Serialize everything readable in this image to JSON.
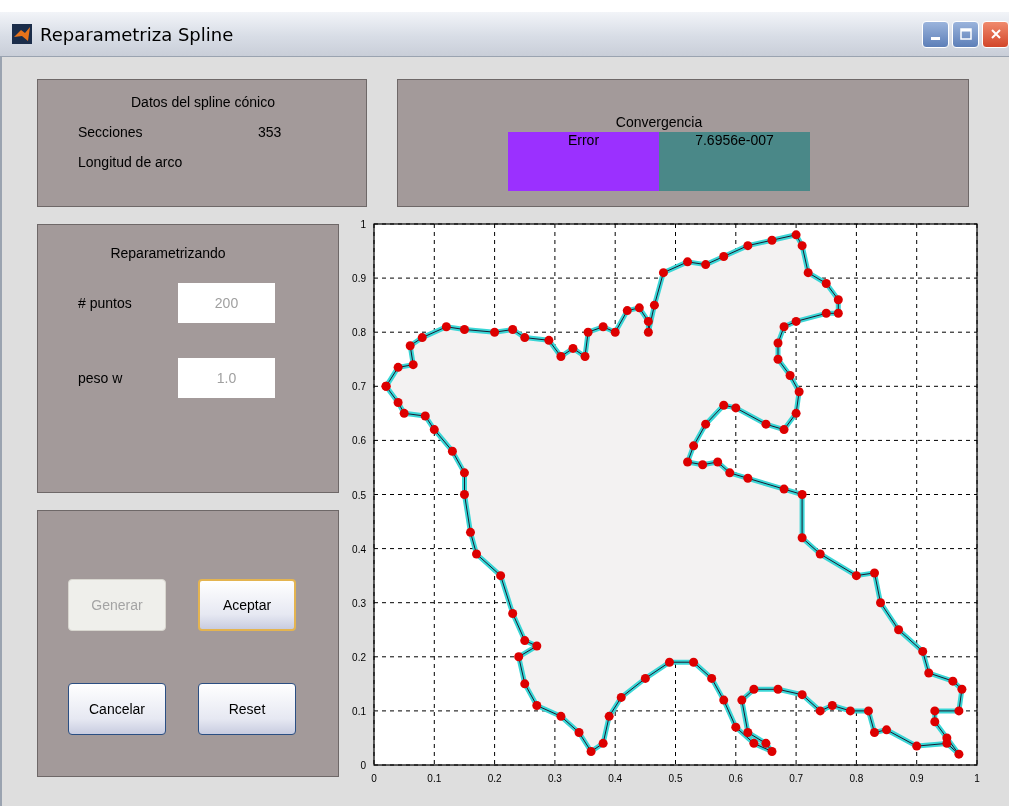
{
  "window": {
    "title": "Reparametriza Spline"
  },
  "spline_panel": {
    "title": "Datos del spline cónico",
    "rows": [
      {
        "label": "Secciones",
        "value": "353"
      },
      {
        "label": "Longitud de arco"
      }
    ]
  },
  "convergence_panel": {
    "title": "Convergencia",
    "cells": [
      {
        "text": "Error",
        "color": "#9b30ff"
      },
      {
        "text": "7.6956e-007",
        "color": "#4a8888"
      }
    ]
  },
  "reparam_panel": {
    "title": "Reparametrizando",
    "fields": [
      {
        "label": "# puntos",
        "value": "200",
        "disabled": true
      },
      {
        "label": "peso w",
        "value": "1.0",
        "disabled": true
      }
    ]
  },
  "buttons": [
    {
      "label": "Generar",
      "disabled": true,
      "focused": false
    },
    {
      "label": "Aceptar",
      "disabled": false,
      "focused": true
    },
    {
      "label": "Cancelar",
      "disabled": false,
      "focused": false
    },
    {
      "label": "Reset",
      "disabled": false,
      "focused": false
    }
  ],
  "plot": {
    "chart_data": {
      "type": "area",
      "grid": true,
      "xlim": [
        0,
        1
      ],
      "ylim": [
        0,
        1
      ],
      "xticks": [
        0,
        0.1,
        0.2,
        0.3,
        0.4,
        0.5,
        0.6,
        0.7,
        0.8,
        0.9,
        1
      ],
      "yticks": [
        0,
        0.1,
        0.2,
        0.3,
        0.4,
        0.5,
        0.6,
        0.7,
        0.8,
        0.9,
        1
      ],
      "x": [
        0.02,
        0.04,
        0.065,
        0.06,
        0.08,
        0.12,
        0.15,
        0.2,
        0.23,
        0.25,
        0.29,
        0.31,
        0.33,
        0.35,
        0.355,
        0.38,
        0.4,
        0.42,
        0.44,
        0.455,
        0.455,
        0.465,
        0.48,
        0.52,
        0.55,
        0.58,
        0.62,
        0.66,
        0.7,
        0.71,
        0.72,
        0.75,
        0.77,
        0.77,
        0.75,
        0.7,
        0.68,
        0.67,
        0.67,
        0.69,
        0.705,
        0.7,
        0.68,
        0.65,
        0.6,
        0.58,
        0.55,
        0.53,
        0.52,
        0.545,
        0.57,
        0.59,
        0.62,
        0.68,
        0.71,
        0.71,
        0.74,
        0.8,
        0.83,
        0.84,
        0.87,
        0.91,
        0.92,
        0.96,
        0.975,
        0.97,
        0.93,
        0.93,
        0.95,
        0.97,
        0.95,
        0.9,
        0.85,
        0.83,
        0.82,
        0.79,
        0.76,
        0.74,
        0.71,
        0.67,
        0.63,
        0.61,
        0.62,
        0.65,
        0.66,
        0.63,
        0.6,
        0.58,
        0.56,
        0.53,
        0.49,
        0.45,
        0.41,
        0.39,
        0.38,
        0.36,
        0.34,
        0.31,
        0.27,
        0.25,
        0.24,
        0.27,
        0.25,
        0.23,
        0.21,
        0.17,
        0.16,
        0.15,
        0.15,
        0.13,
        0.1,
        0.085,
        0.05,
        0.04,
        0.02
      ],
      "series": [
        {
          "color": "#dd0000",
          "values": [
            0.7,
            0.735,
            0.74,
            0.775,
            0.79,
            0.81,
            0.805,
            0.8,
            0.805,
            0.79,
            0.785,
            0.755,
            0.77,
            0.755,
            0.8,
            0.81,
            0.8,
            0.84,
            0.845,
            0.82,
            0.8,
            0.85,
            0.91,
            0.93,
            0.925,
            0.94,
            0.96,
            0.97,
            0.98,
            0.96,
            0.91,
            0.89,
            0.86,
            0.835,
            0.835,
            0.82,
            0.81,
            0.78,
            0.75,
            0.72,
            0.69,
            0.65,
            0.62,
            0.63,
            0.66,
            0.665,
            0.63,
            0.59,
            0.56,
            0.555,
            0.56,
            0.54,
            0.53,
            0.51,
            0.5,
            0.42,
            0.39,
            0.35,
            0.355,
            0.3,
            0.25,
            0.21,
            0.17,
            0.155,
            0.14,
            0.1,
            0.1,
            0.08,
            0.05,
            0.02,
            0.04,
            0.035,
            0.065,
            0.06,
            0.1,
            0.1,
            0.11,
            0.1,
            0.13,
            0.14,
            0.14,
            0.12,
            0.06,
            0.04,
            0.025,
            0.04,
            0.07,
            0.12,
            0.16,
            0.19,
            0.19,
            0.16,
            0.125,
            0.09,
            0.04,
            0.025,
            0.06,
            0.09,
            0.11,
            0.15,
            0.2,
            0.22,
            0.23,
            0.28,
            0.35,
            0.39,
            0.43,
            0.5,
            0.54,
            0.58,
            0.62,
            0.645,
            0.65,
            0.67,
            0.7
          ]
        }
      ]
    }
  }
}
